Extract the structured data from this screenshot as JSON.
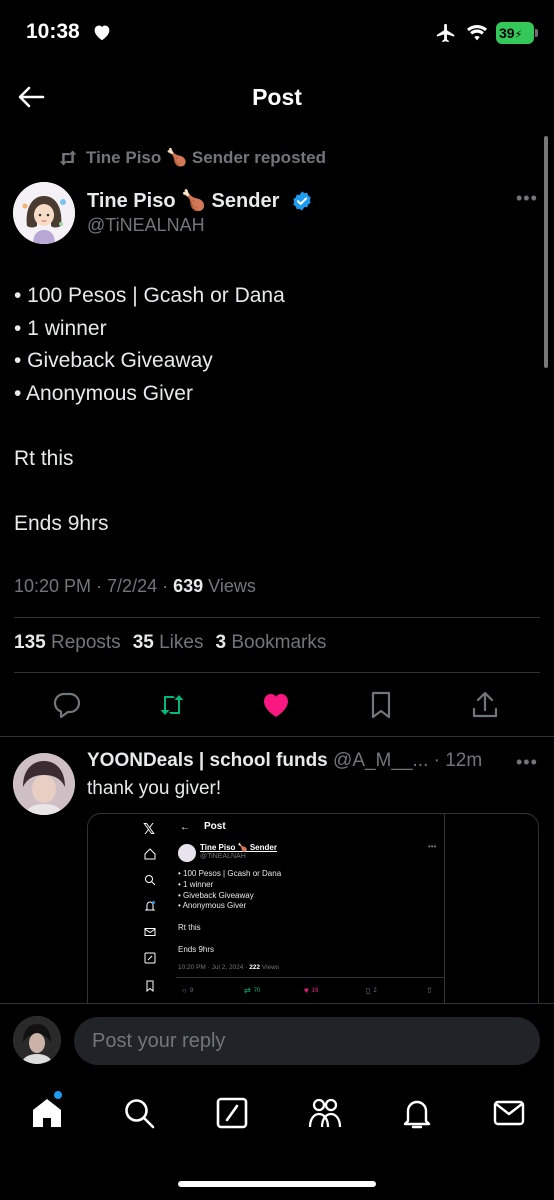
{
  "status_bar": {
    "time": "10:38",
    "battery": "39"
  },
  "header": {
    "title": "Post"
  },
  "repost_context": {
    "text": "Tine Piso 🍗 Sender reposted"
  },
  "post": {
    "author_name": "Tine Piso 🍗 Sender",
    "author_handle": "@TiNEALNAH",
    "lines": [
      "• 100 Pesos | Gcash or Dana",
      "• 1 winner",
      "• Giveback Giveaway",
      "• Anonymous Giver",
      "",
      "Rt this",
      "",
      "Ends 9hrs"
    ],
    "timestamp": "10:20 PM · 7/2/24 · ",
    "views_count": "639",
    "views_label": " Views",
    "stats": {
      "reposts_count": "135",
      "reposts_label": "Reposts",
      "likes_count": "35",
      "likes_label": "Likes",
      "bookmarks_count": "3",
      "bookmarks_label": "Bookmarks"
    }
  },
  "reply": {
    "name": "YOONDeals | school funds",
    "handle": "@A_M__...",
    "time": " · 12m",
    "text": "thank you giver!",
    "embed": {
      "x_logo": "𝕏",
      "title": "Post",
      "author_name": "Tine Piso 🍗 Sender",
      "author_handle": "@TiNEALNAH",
      "lines": [
        "• 100 Pesos | Gcash or Dana",
        "• 1 winner",
        "• Giveback Giveaway",
        "• Anonymous Giver",
        "",
        "Rt this",
        "",
        "Ends 9hrs"
      ],
      "timestamp": "10:20 PM · Jul 2, 2024 · ",
      "views_count": "222",
      "views_label": " Views",
      "counts": {
        "replies": "9",
        "reposts": "70",
        "likes": "16",
        "bookmarks": "2"
      }
    }
  },
  "compose": {
    "placeholder": "Post your reply"
  },
  "colors": {
    "like": "#f91880",
    "repost": "#00ba7c",
    "verified": "#1d9bf0",
    "muted": "#71767b"
  },
  "icons": [
    "back-arrow-icon",
    "repost-icon",
    "verified-icon",
    "reply-icon",
    "like-icon",
    "bookmark-icon",
    "share-icon",
    "home-icon",
    "search-icon",
    "grok-icon",
    "communities-icon",
    "notifications-icon",
    "messages-icon"
  ]
}
